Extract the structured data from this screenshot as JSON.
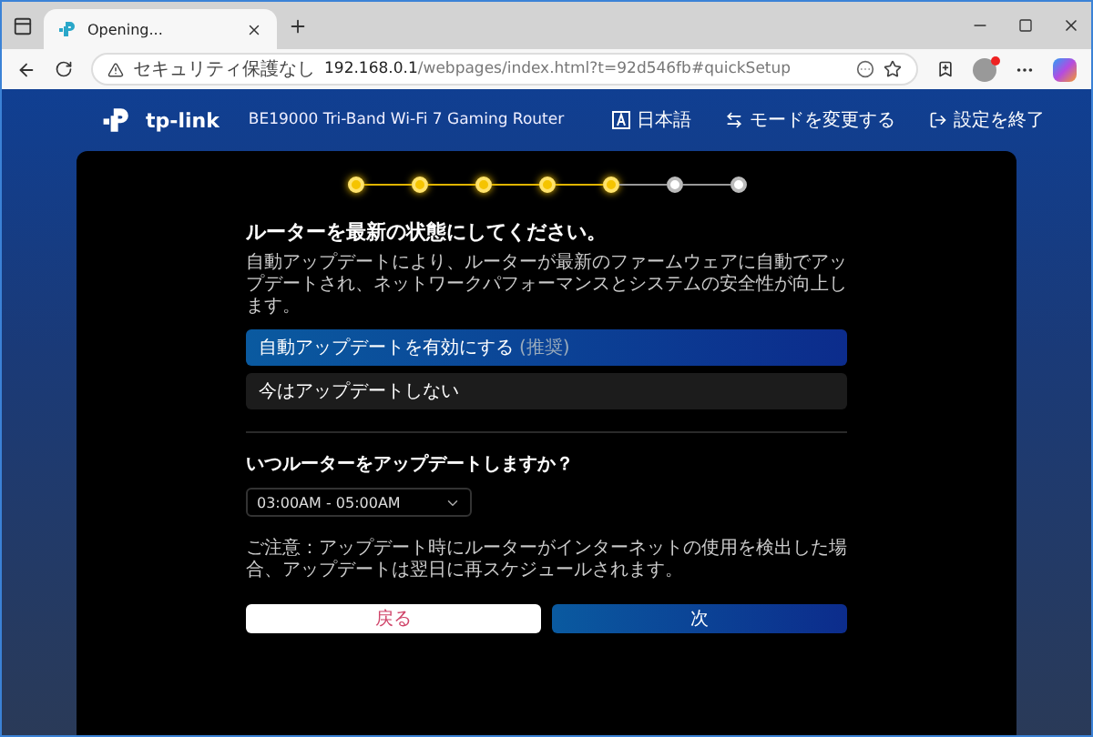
{
  "browser": {
    "tab_title": "Opening...",
    "security_label": "セキュリティ保護なし",
    "url_host": "192.168.0.1",
    "url_path": "/webpages/index.html?t=92d546fb#quickSetup"
  },
  "header": {
    "brand": "tp-link",
    "model": "BE19000 Tri-Band Wi-Fi 7 Gaming Router",
    "actions": [
      {
        "kind": "language",
        "label": "日本語"
      },
      {
        "kind": "mode",
        "label": "モードを変更する"
      },
      {
        "kind": "exit",
        "label": "設定を終了"
      }
    ]
  },
  "steps": [
    {
      "done": true
    },
    {
      "done": true
    },
    {
      "done": true
    },
    {
      "done": true
    },
    {
      "done": true
    },
    {
      "done": false
    },
    {
      "done": false
    }
  ],
  "title": "ルーターを最新の状態にしてください。",
  "description": "自動アップデートにより、ルーターが最新のファームウェアに自動でアップデートされ、ネットワークパフォーマンスとシステムの安全性が向上します。",
  "options": [
    {
      "label": "自動アップデートを有効にする",
      "tag": "(推奨)",
      "selected": true
    },
    {
      "label": "今はアップデートしない",
      "selected": false
    }
  ],
  "question": "いつルーターをアップデートしますか？",
  "schedule": {
    "value": "03:00AM - 05:00AM"
  },
  "note": "ご注意：アップデート時にルーターがインターネットの使用を検出した場合、アップデートは翌日に再スケジュールされます。",
  "buttons": {
    "back": "戻る",
    "next": "次"
  }
}
